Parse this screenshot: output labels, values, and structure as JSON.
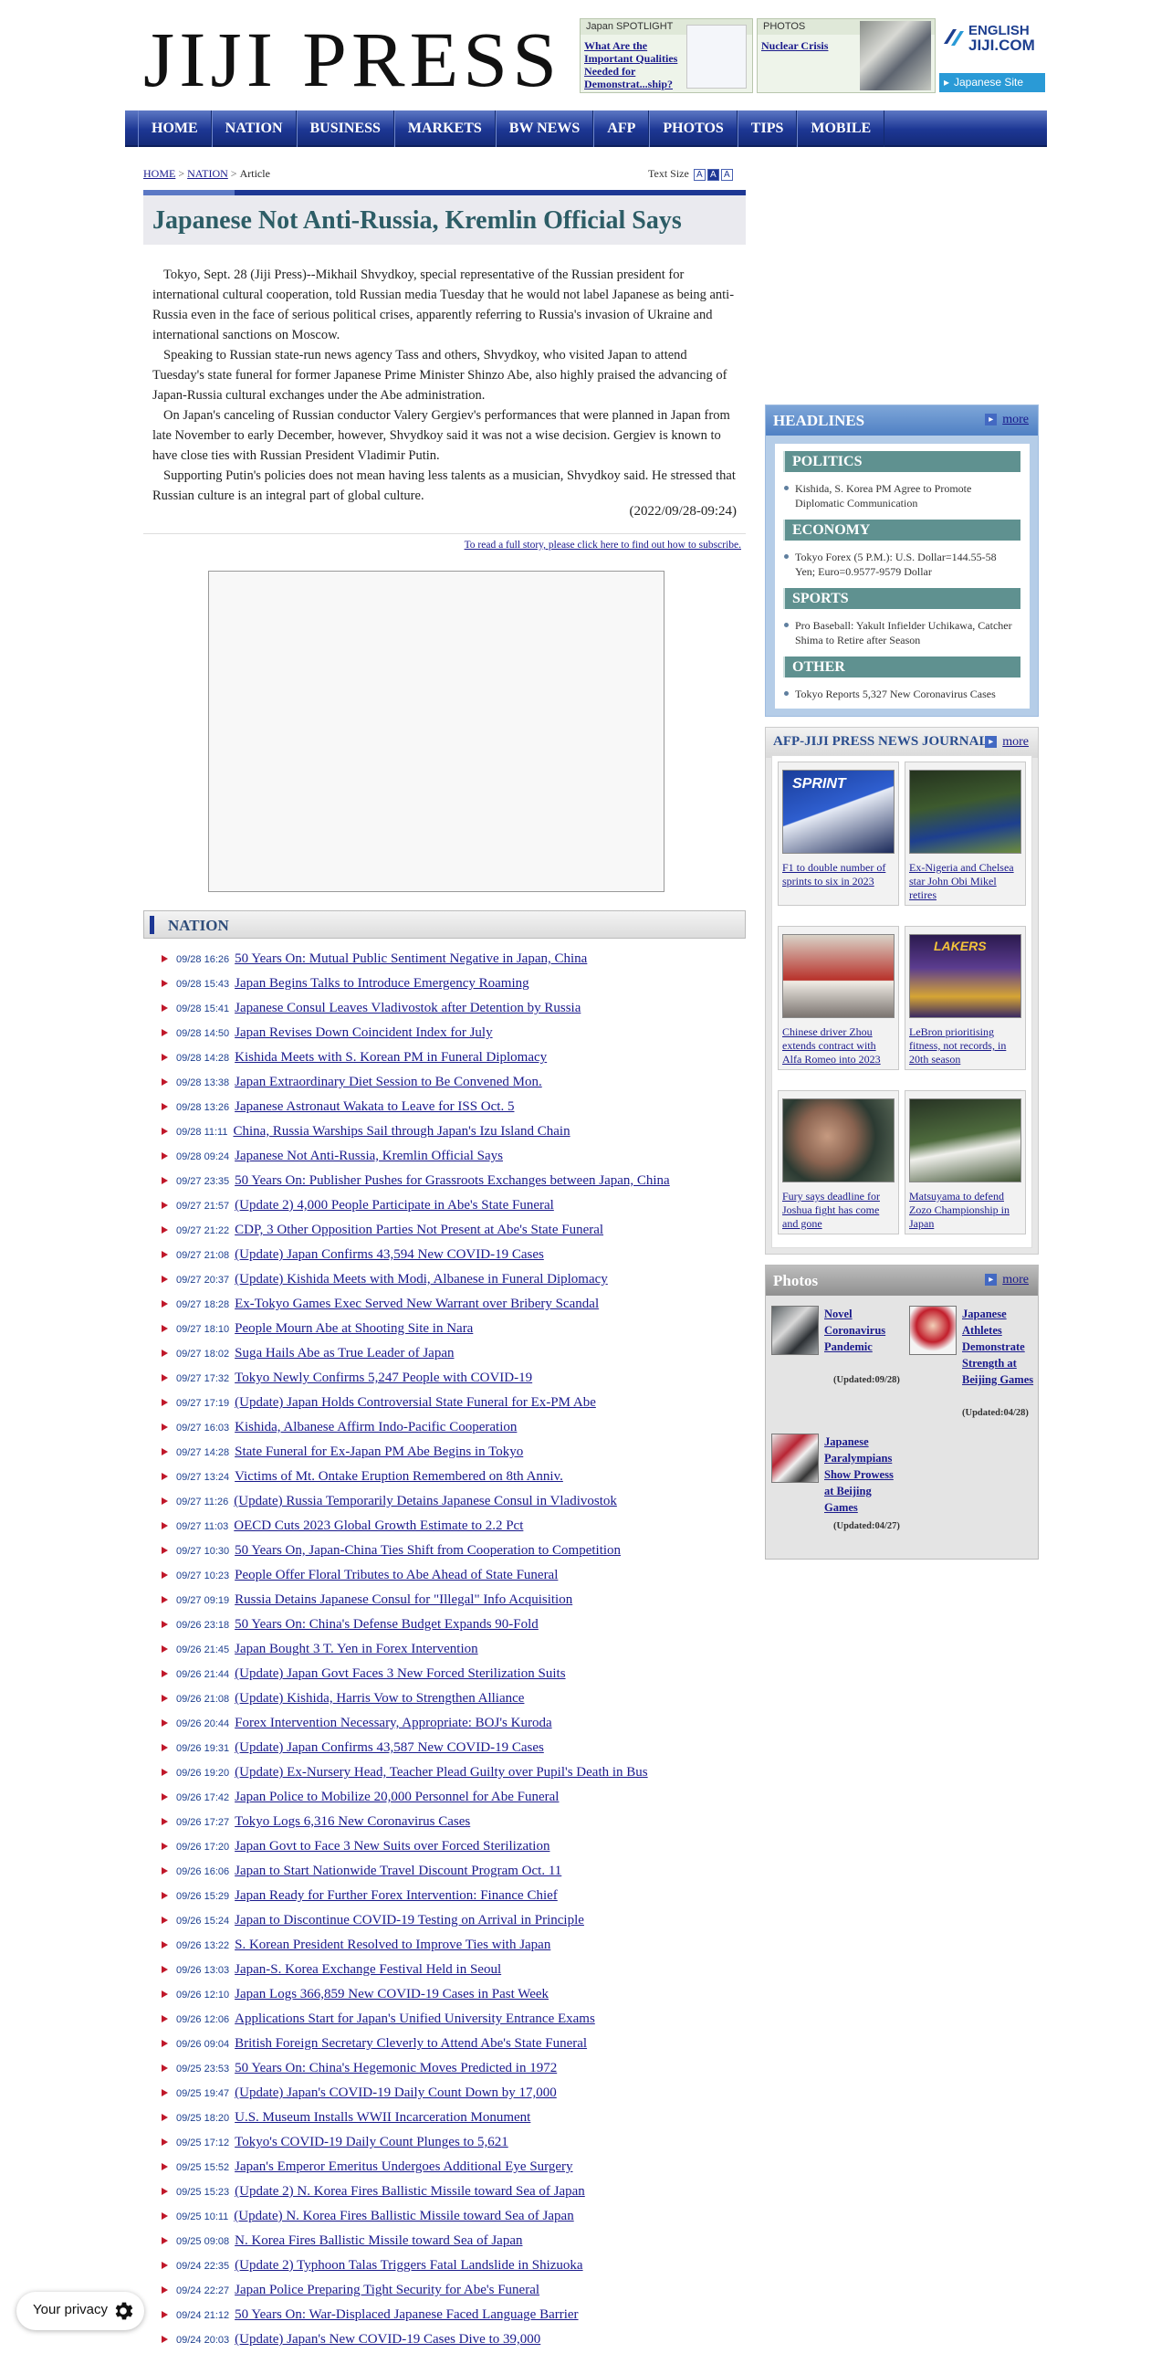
{
  "header": {
    "logo": "JIJI PRESS",
    "spotlight": {
      "label": "Japan SPOTLIGHT",
      "link": "What Are the Important Qualities Needed for Demonstrat...ship?"
    },
    "photos": {
      "label": "PHOTOS",
      "link": "Nuclear Crisis"
    },
    "english_badge": {
      "line1": "ENGLISH",
      "line2": "JIJI.COM"
    },
    "japanese_site": "Japanese Site"
  },
  "nav": [
    "HOME",
    "NATION",
    "BUSINESS",
    "MARKETS",
    "BW NEWS",
    "AFP",
    "PHOTOS",
    "TIPS",
    "MOBILE"
  ],
  "breadcrumb": {
    "home": "HOME",
    "sep": ">",
    "nation": "NATION",
    "current": "Article"
  },
  "text_size": {
    "label": "Text Size",
    "options": [
      "A",
      "A",
      "A"
    ]
  },
  "article": {
    "title": "Japanese Not Anti-Russia, Kremlin Official Says",
    "paragraphs": [
      "Tokyo, Sept. 28 (Jiji Press)--Mikhail Shvydkoy, special representative of the Russian president for international cultural cooperation, told Russian media Tuesday that he would not label Japanese as being anti-Russia even in the face of serious political crises, apparently referring to Russia's invasion of Ukraine and international sanctions on Moscow.",
      "Speaking to Russian state-run news agency Tass and others, Shvydkoy, who visited Japan to attend Tuesday's state funeral for former Japanese Prime Minister Shinzo Abe, also highly praised the advancing of Japan-Russia cultural exchanges under the Abe administration.",
      "On Japan's canceling of Russian conductor Valery Gergiev's performances that were planned in Japan from late November to early December, however, Shvydkoy said it was not a wise decision. Gergiev is known to have close ties with Russian President Vladimir Putin.",
      "Supporting Putin's policies does not mean having less talents as a musician, Shvydkoy said. He stressed that Russian culture is an integral part of global culture."
    ],
    "timestamp": "(2022/09/28-09:24)",
    "subscribe": "To read a full story, please click here to find out how to subscribe."
  },
  "nation": {
    "heading": "NATION",
    "items": [
      {
        "date": "09/28 16:26",
        "title": "50 Years On: Mutual Public Sentiment Negative in Japan, China"
      },
      {
        "date": "09/28 15:43",
        "title": "Japan Begins Talks to Introduce Emergency Roaming"
      },
      {
        "date": "09/28 15:41",
        "title": "Japanese Consul Leaves Vladivostok after Detention by Russia"
      },
      {
        "date": "09/28 14:50",
        "title": "Japan Revises Down Coincident Index for July"
      },
      {
        "date": "09/28 14:28",
        "title": "Kishida Meets with S. Korean PM in Funeral Diplomacy"
      },
      {
        "date": "09/28 13:38",
        "title": "Japan Extraordinary Diet Session to Be Convened Mon."
      },
      {
        "date": "09/28 13:26",
        "title": "Japanese Astronaut Wakata to Leave for ISS Oct. 5"
      },
      {
        "date": "09/28 11:11",
        "title": "China, Russia Warships Sail through Japan's Izu Island Chain"
      },
      {
        "date": "09/28 09:24",
        "title": "Japanese Not Anti-Russia, Kremlin Official Says"
      },
      {
        "date": "09/27 23:35",
        "title": "50 Years On: Publisher Pushes for Grassroots Exchanges between Japan, China"
      },
      {
        "date": "09/27 21:57",
        "title": "(Update 2) 4,000 People Participate in Abe's State Funeral"
      },
      {
        "date": "09/27 21:22",
        "title": "CDP, 3 Other Opposition Parties Not Present at Abe's State Funeral"
      },
      {
        "date": "09/27 21:08",
        "title": "(Update) Japan Confirms 43,594 New COVID-19 Cases"
      },
      {
        "date": "09/27 20:37",
        "title": "(Update) Kishida Meets with Modi, Albanese in Funeral Diplomacy"
      },
      {
        "date": "09/27 18:28",
        "title": "Ex-Tokyo Games Exec Served New Warrant over Bribery Scandal"
      },
      {
        "date": "09/27 18:10",
        "title": "People Mourn Abe at Shooting Site in Nara"
      },
      {
        "date": "09/27 18:02",
        "title": "Suga Hails Abe as True Leader of Japan"
      },
      {
        "date": "09/27 17:32",
        "title": "Tokyo Newly Confirms 5,247 People with COVID-19"
      },
      {
        "date": "09/27 17:19",
        "title": "(Update) Japan Holds Controversial State Funeral for Ex-PM Abe"
      },
      {
        "date": "09/27 16:03",
        "title": "Kishida, Albanese Affirm Indo-Pacific Cooperation"
      },
      {
        "date": "09/27 14:28",
        "title": "State Funeral for Ex-Japan PM Abe Begins in Tokyo"
      },
      {
        "date": "09/27 13:24",
        "title": "Victims of Mt. Ontake Eruption Remembered on 8th Anniv."
      },
      {
        "date": "09/27 11:26",
        "title": "(Update) Russia Temporarily Detains Japanese Consul in Vladivostok"
      },
      {
        "date": "09/27 11:03",
        "title": "OECD Cuts 2023 Global Growth Estimate to 2.2 Pct"
      },
      {
        "date": "09/27 10:30",
        "title": "50 Years On, Japan-China Ties Shift from Cooperation to Competition"
      },
      {
        "date": "09/27 10:23",
        "title": "People Offer Floral Tributes to Abe Ahead of State Funeral"
      },
      {
        "date": "09/27 09:19",
        "title": "Russia Detains Japanese Consul for \"Illegal\" Info Acquisition"
      },
      {
        "date": "09/26 23:18",
        "title": "50 Years On: China's Defense Budget Expands 90-Fold"
      },
      {
        "date": "09/26 21:45",
        "title": "Japan Bought 3 T. Yen in Forex Intervention"
      },
      {
        "date": "09/26 21:44",
        "title": "(Update) Japan Govt Faces 3 New Forced Sterilization Suits"
      },
      {
        "date": "09/26 21:08",
        "title": "(Update) Kishida, Harris Vow to Strengthen Alliance"
      },
      {
        "date": "09/26 20:44",
        "title": "Forex Intervention Necessary, Appropriate: BOJ's Kuroda"
      },
      {
        "date": "09/26 19:31",
        "title": "(Update) Japan Confirms 43,587 New COVID-19 Cases"
      },
      {
        "date": "09/26 19:20",
        "title": "(Update) Ex-Nursery Head, Teacher Plead Guilty over Pupil's Death in Bus"
      },
      {
        "date": "09/26 17:42",
        "title": "Japan Police to Mobilize 20,000 Personnel for Abe Funeral"
      },
      {
        "date": "09/26 17:27",
        "title": "Tokyo Logs 6,316 New Coronavirus Cases"
      },
      {
        "date": "09/26 17:20",
        "title": "Japan Govt to Face 3 New Suits over Forced Sterilization"
      },
      {
        "date": "09/26 16:06",
        "title": "Japan to Start Nationwide Travel Discount Program Oct. 11"
      },
      {
        "date": "09/26 15:29",
        "title": "Japan Ready for Further Forex Intervention: Finance Chief"
      },
      {
        "date": "09/26 15:24",
        "title": "Japan to Discontinue COVID-19 Testing on Arrival in Principle"
      },
      {
        "date": "09/26 13:22",
        "title": "S. Korean President Resolved to Improve Ties with Japan"
      },
      {
        "date": "09/26 13:03",
        "title": "Japan-S. Korea Exchange Festival Held in Seoul"
      },
      {
        "date": "09/26 12:10",
        "title": "Japan Logs 366,859 New COVID-19 Cases in Past Week"
      },
      {
        "date": "09/26 12:06",
        "title": "Applications Start for Japan's Unified University Entrance Exams"
      },
      {
        "date": "09/26 09:04",
        "title": "British Foreign Secretary Cleverly to Attend Abe's State Funeral"
      },
      {
        "date": "09/25 23:53",
        "title": "50 Years On: China's Hegemonic Moves Predicted in 1972"
      },
      {
        "date": "09/25 19:47",
        "title": "(Update) Japan's COVID-19 Daily Count Down by 17,000"
      },
      {
        "date": "09/25 18:20",
        "title": "U.S. Museum Installs WWII Incarceration Monument"
      },
      {
        "date": "09/25 17:12",
        "title": "Tokyo's COVID-19 Daily Count Plunges to 5,621"
      },
      {
        "date": "09/25 15:52",
        "title": "Japan's Emperor Emeritus Undergoes Additional Eye Surgery"
      },
      {
        "date": "09/25 15:23",
        "title": "(Update 2) N. Korea Fires Ballistic Missile toward Sea of Japan"
      },
      {
        "date": "09/25 10:11",
        "title": "(Update) N. Korea Fires Ballistic Missile toward Sea of Japan"
      },
      {
        "date": "09/25 09:08",
        "title": "N. Korea Fires Ballistic Missile toward Sea of Japan"
      },
      {
        "date": "09/24 22:35",
        "title": "(Update 2) Typhoon Talas Triggers Fatal Landslide in Shizuoka"
      },
      {
        "date": "09/24 22:27",
        "title": "Japan Police Preparing Tight Security for Abe's Funeral"
      },
      {
        "date": "09/24 21:12",
        "title": "50 Years On: War-Displaced Japanese Faced Language Barrier"
      },
      {
        "date": "09/24 20:03",
        "title": "(Update) Japan's New COVID-19 Cases Dive to 39,000"
      }
    ]
  },
  "headlines": {
    "heading": "HEADLINES",
    "more": "more",
    "sections": [
      {
        "category": "POLITICS",
        "item": "Kishida, S. Korea PM Agree to Promote Diplomatic Communication"
      },
      {
        "category": "ECONOMY",
        "item": "Tokyo Forex (5 P.M.): U.S. Dollar=144.55-58 Yen; Euro=0.9577-9579 Dollar"
      },
      {
        "category": "SPORTS",
        "item": "Pro Baseball: Yakult Infielder Uchikawa, Catcher Shima to Retire after Season"
      },
      {
        "category": "OTHER",
        "item": "Tokyo Reports 5,327 New Coronavirus Cases"
      }
    ]
  },
  "afp": {
    "heading": "AFP-JIJI PRESS NEWS JOURNAL",
    "more": "more",
    "cards": [
      {
        "caption": "F1 to double number of sprints to six in 2023",
        "tag": "SPRINT"
      },
      {
        "caption": "Ex-Nigeria and Chelsea star John Obi Mikel retires",
        "tag": ""
      },
      {
        "caption": "Chinese driver Zhou extends contract with Alfa Romeo into 2023",
        "tag": ""
      },
      {
        "caption": "LeBron prioritising fitness, not records, in 20th season",
        "tag": "LAKERS"
      },
      {
        "caption": "Fury says deadline for Joshua fight has come and gone",
        "tag": ""
      },
      {
        "caption": "Matsuyama to defend Zozo Championship in Japan",
        "tag": ""
      }
    ]
  },
  "photos_box": {
    "heading": "Photos",
    "more": "more",
    "items": [
      {
        "caption": "Novel Coronavirus Pandemic",
        "updated": "(Updated:09/28)"
      },
      {
        "caption": "Japanese Athletes Demonstrate Strength at Beijing Games",
        "updated": "(Updated:04/28)"
      },
      {
        "caption": "Japanese Paralympians Show Prowess at Beijing Games",
        "updated": "(Updated:04/27)"
      }
    ]
  },
  "privacy": "Your privacy",
  "colors": {
    "nav": "#1d3794",
    "title": "#2d5d66",
    "link": "#1a1a8c",
    "category": "#5f9190",
    "bullet": "#c0182a"
  }
}
